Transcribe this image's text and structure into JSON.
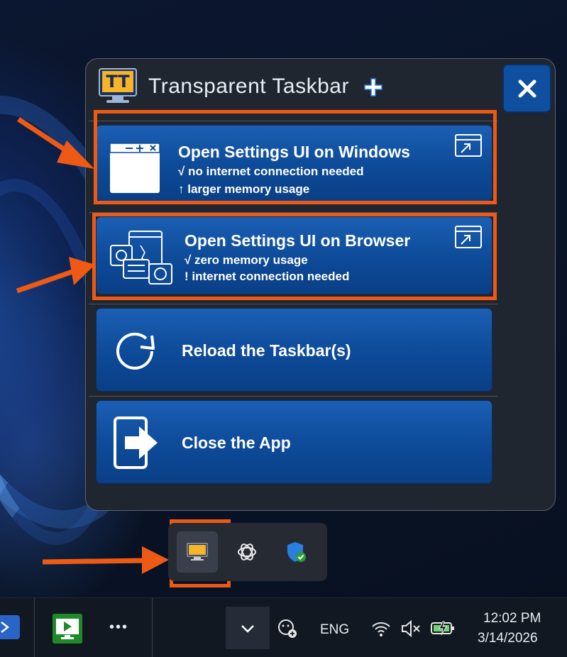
{
  "app": {
    "title": "Transparent Taskbar",
    "logo_text": "TT"
  },
  "cards": [
    {
      "title": "Open Settings UI on Windows",
      "lines": [
        "√ no internet connection needed",
        "↑ larger memory usage"
      ]
    },
    {
      "title": "Open Settings UI on Browser",
      "lines": [
        "√ zero memory usage",
        "! internet connection needed"
      ]
    },
    {
      "title": "Reload the Taskbar(s)"
    },
    {
      "title": "Close the App"
    }
  ],
  "tray_overflow": {
    "icons": [
      "transparent-taskbar-tray-icon",
      "chatgpt-icon",
      "security-shield-icon"
    ]
  },
  "taskbar": {
    "more_label": "•••",
    "language": "ENG",
    "time": "12:02 PM",
    "date": "3/14/2026"
  },
  "colors": {
    "accent": "#0e4fa0",
    "highlight": "#ee5a16",
    "panel_bg": "#20262f"
  }
}
